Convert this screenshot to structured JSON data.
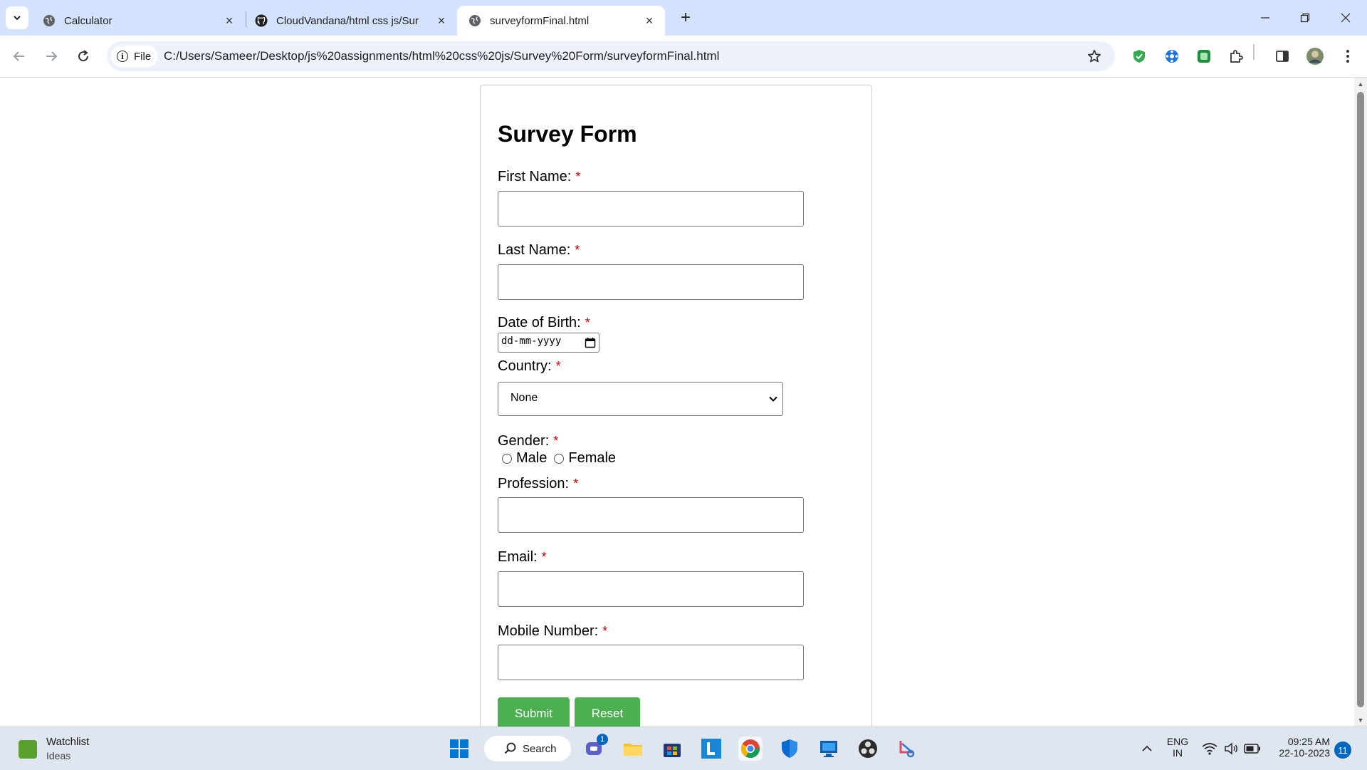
{
  "browser": {
    "tabs": [
      {
        "title": "Calculator"
      },
      {
        "title": "CloudVandana/html css js/Sur"
      },
      {
        "title": "surveyformFinal.html"
      }
    ],
    "omnibox": {
      "chip_label": "File",
      "url": "C:/Users/Sameer/Desktop/js%20assignments/html%20css%20js/Survey%20Form/surveyformFinal.html"
    }
  },
  "form": {
    "title": "Survey Form",
    "required_mark": "*",
    "first_name_label": "First Name:",
    "last_name_label": "Last Name:",
    "dob_label": "Date of Birth:",
    "dob_placeholder": "dd-mm-yyyy",
    "country_label": "Country:",
    "country_selected": "None",
    "gender_label": "Gender:",
    "gender_male": "Male",
    "gender_female": "Female",
    "profession_label": "Profession:",
    "email_label": "Email:",
    "mobile_label": "Mobile Number:",
    "submit_label": "Submit",
    "reset_label": "Reset",
    "accent_color": "#4caf50",
    "required_color": "#d10000"
  },
  "taskbar": {
    "widget_title": "Watchlist",
    "widget_subtitle": "Ideas",
    "search_label": "Search",
    "chat_badge": "1",
    "language_line1": "ENG",
    "language_line2": "IN",
    "time": "09:25 AM",
    "date": "22-10-2023",
    "notification_count": "11"
  }
}
